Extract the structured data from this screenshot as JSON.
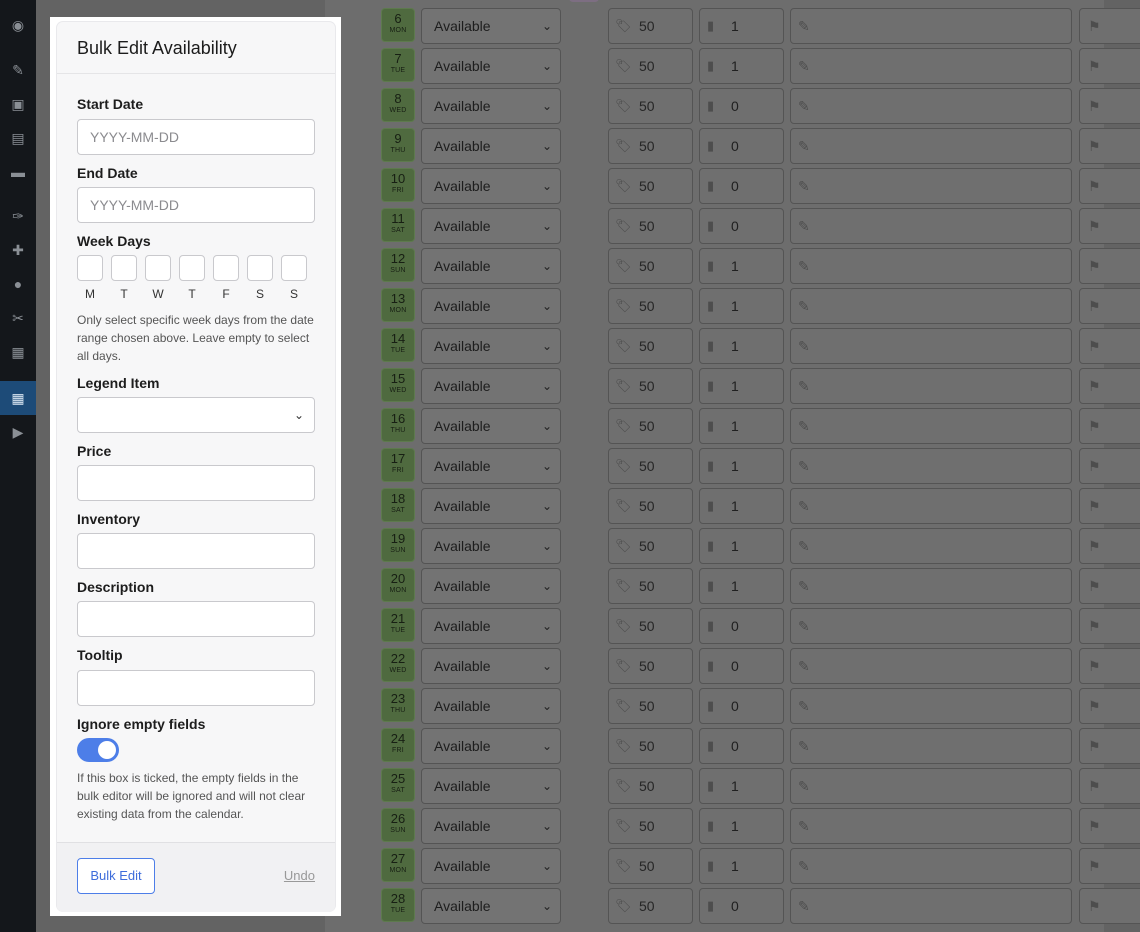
{
  "sidebar": {
    "icons": [
      "dashboard-icon",
      "pin-icon",
      "media-icon",
      "pages-icon",
      "comments-icon",
      "appearance-icon",
      "plugins-icon",
      "users-icon",
      "tools-icon",
      "settings-icon",
      "calendar-icon",
      "play-icon"
    ]
  },
  "rows": [
    {
      "day": "6",
      "wd": "MON",
      "status": "Available",
      "price": "50",
      "inventory": "1"
    },
    {
      "day": "7",
      "wd": "TUE",
      "status": "Available",
      "price": "50",
      "inventory": "1"
    },
    {
      "day": "8",
      "wd": "WED",
      "status": "Available",
      "price": "50",
      "inventory": "0"
    },
    {
      "day": "9",
      "wd": "THU",
      "status": "Available",
      "price": "50",
      "inventory": "0"
    },
    {
      "day": "10",
      "wd": "FRI",
      "status": "Available",
      "price": "50",
      "inventory": "0"
    },
    {
      "day": "11",
      "wd": "SAT",
      "status": "Available",
      "price": "50",
      "inventory": "0"
    },
    {
      "day": "12",
      "wd": "SUN",
      "status": "Available",
      "price": "50",
      "inventory": "1"
    },
    {
      "day": "13",
      "wd": "MON",
      "status": "Available",
      "price": "50",
      "inventory": "1"
    },
    {
      "day": "14",
      "wd": "TUE",
      "status": "Available",
      "price": "50",
      "inventory": "1"
    },
    {
      "day": "15",
      "wd": "WED",
      "status": "Available",
      "price": "50",
      "inventory": "1"
    },
    {
      "day": "16",
      "wd": "THU",
      "status": "Available",
      "price": "50",
      "inventory": "1"
    },
    {
      "day": "17",
      "wd": "FRI",
      "status": "Available",
      "price": "50",
      "inventory": "1"
    },
    {
      "day": "18",
      "wd": "SAT",
      "status": "Available",
      "price": "50",
      "inventory": "1"
    },
    {
      "day": "19",
      "wd": "SUN",
      "status": "Available",
      "price": "50",
      "inventory": "1"
    },
    {
      "day": "20",
      "wd": "MON",
      "status": "Available",
      "price": "50",
      "inventory": "1"
    },
    {
      "day": "21",
      "wd": "TUE",
      "status": "Available",
      "price": "50",
      "inventory": "0"
    },
    {
      "day": "22",
      "wd": "WED",
      "status": "Available",
      "price": "50",
      "inventory": "0"
    },
    {
      "day": "23",
      "wd": "THU",
      "status": "Available",
      "price": "50",
      "inventory": "0"
    },
    {
      "day": "24",
      "wd": "FRI",
      "status": "Available",
      "price": "50",
      "inventory": "0"
    },
    {
      "day": "25",
      "wd": "SAT",
      "status": "Available",
      "price": "50",
      "inventory": "1"
    },
    {
      "day": "26",
      "wd": "SUN",
      "status": "Available",
      "price": "50",
      "inventory": "1"
    },
    {
      "day": "27",
      "wd": "MON",
      "status": "Available",
      "price": "50",
      "inventory": "1"
    },
    {
      "day": "28",
      "wd": "TUE",
      "status": "Available",
      "price": "50",
      "inventory": "0"
    }
  ],
  "modal": {
    "title": "Bulk Edit Availability",
    "start_date_label": "Start Date",
    "start_date_placeholder": "YYYY-MM-DD",
    "end_date_label": "End Date",
    "end_date_placeholder": "YYYY-MM-DD",
    "week_days_label": "Week Days",
    "week_days": [
      "M",
      "T",
      "W",
      "T",
      "F",
      "S",
      "S"
    ],
    "week_days_help": "Only select specific week days from the date range chosen above. Leave empty to select all days.",
    "legend_item_label": "Legend Item",
    "price_label": "Price",
    "inventory_label": "Inventory",
    "description_label": "Description",
    "tooltip_label": "Tooltip",
    "ignore_empty_label": "Ignore empty fields",
    "ignore_empty_enabled": true,
    "ignore_empty_help": "If this box is ticked, the empty fields in the bulk editor will be ignored and will not clear existing data from the calendar.",
    "bulk_edit_button": "Bulk Edit",
    "undo_link": "Undo"
  },
  "colors": {
    "accent": "#4d7ee8",
    "overlay": "#636363",
    "day_cell": "#4f6a3f",
    "sidebar": "#14171b",
    "active_sidebar": "#1d4b78"
  }
}
